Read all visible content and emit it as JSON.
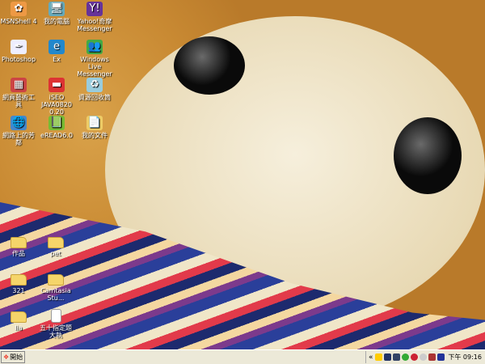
{
  "desktop": {
    "icons": [
      {
        "label": "MSNShell 4",
        "glyph": "✿",
        "color": "#e94",
        "col": 0,
        "row": 0
      },
      {
        "label": "我的電腦",
        "glyph": "🖥",
        "color": "#6ab",
        "col": 1,
        "row": 0
      },
      {
        "label": "Yahoo!奇摩 Messenger",
        "glyph": "Y!",
        "color": "#639",
        "col": 2,
        "row": 0
      },
      {
        "label": "Photoshop",
        "glyph": "✒",
        "color": "#eef",
        "col": 0,
        "row": 1
      },
      {
        "label": "Ex",
        "glyph": "e",
        "color": "#28c",
        "col": 1,
        "row": 1
      },
      {
        "label": "Windows Live Messenger",
        "glyph": "👥",
        "color": "#4a4",
        "col": 2,
        "row": 1
      },
      {
        "label": "網頁藝術工具",
        "glyph": "▦",
        "color": "#c44",
        "col": 0,
        "row": 2
      },
      {
        "label": "iSEO JAVA0820 0.20",
        "glyph": "▬",
        "color": "#d33",
        "col": 1,
        "row": 2
      },
      {
        "label": "資源回收筒",
        "glyph": "♻",
        "color": "#9cd",
        "col": 2,
        "row": 2
      },
      {
        "label": "網路上的芳鄰",
        "glyph": "🌐",
        "color": "#48c",
        "col": 0,
        "row": 3
      },
      {
        "label": "eREAD6.0",
        "glyph": "📗",
        "color": "#7b3",
        "col": 1,
        "row": 3
      },
      {
        "label": "我的文件",
        "glyph": "📄",
        "color": "#ec6",
        "col": 2,
        "row": 3
      }
    ],
    "folders": [
      {
        "label": "作品",
        "col": 0,
        "row": 0
      },
      {
        "label": "pet",
        "col": 1,
        "row": 0
      },
      {
        "label": "321",
        "col": 0,
        "row": 1
      },
      {
        "label": "Camtasia Stu...",
        "col": 1,
        "row": 1
      },
      {
        "label": "lia",
        "col": 0,
        "row": 2
      },
      {
        "label": "五十指定題大執",
        "col": 1,
        "row": 2,
        "doc": true
      }
    ]
  },
  "taskbar": {
    "start_label": "開始",
    "clock": "下午 09:16",
    "tray_chevron": "«",
    "tray_icons": [
      "shield",
      "network-error",
      "network",
      "user",
      "antivirus",
      "chat",
      "monitor-error",
      "book"
    ]
  }
}
